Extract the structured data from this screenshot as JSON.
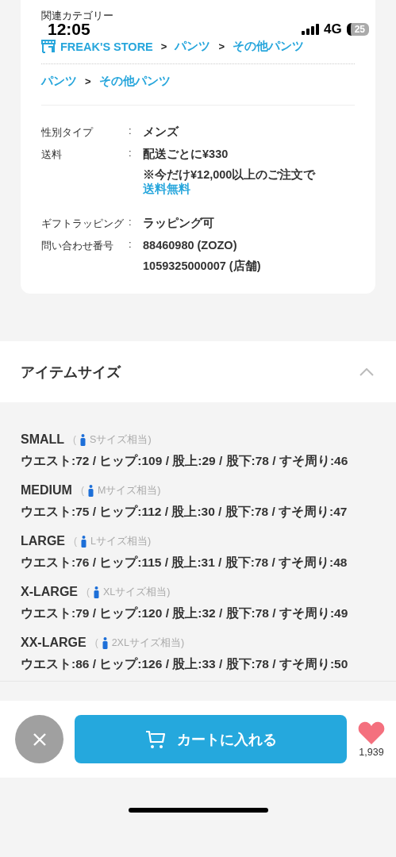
{
  "status_bar": {
    "time": "12:05",
    "network": "4G",
    "battery": "25"
  },
  "related_category": {
    "heading": "関連カテゴリー",
    "paths": [
      {
        "links": [
          {
            "text": "FREAK'S STORE",
            "kind": "shop"
          },
          {
            "separator": ">",
            "text": "パンツ"
          },
          {
            "separator": ">",
            "text": "その他パンツ"
          }
        ]
      },
      {
        "links": [
          {
            "text": "パンツ"
          },
          {
            "separator": ">",
            "text": "その他パンツ"
          }
        ]
      }
    ]
  },
  "details": [
    {
      "label": "性別タイプ",
      "colon": ":",
      "values": [
        {
          "text": "メンズ"
        }
      ]
    },
    {
      "label": "送料",
      "colon": ":",
      "values": [
        {
          "text": "配送ごとに¥330"
        },
        {
          "text": "※今だけ¥12,000以上のご注文で",
          "link": "送料無料"
        }
      ]
    },
    {
      "label": "ギフトラッピング",
      "colon": ":",
      "values": [
        {
          "text": "ラッピング可"
        }
      ]
    },
    {
      "label": "問い合わせ番号",
      "colon": ":",
      "values": [
        {
          "text": "88460980 (ZOZO)"
        },
        {
          "text": "1059325000007 (店舗)"
        }
      ]
    }
  ],
  "item_size": {
    "title": "アイテムサイズ",
    "expanded": true,
    "sizes": [
      {
        "name": "SMALL",
        "open": "(",
        "equivalent": "Sサイズ相当)",
        "measurements": "ウエスト:72 / ヒップ:109 / 股上:29 / 股下:78 / すそ周り:46"
      },
      {
        "name": "MEDIUM",
        "open": "(",
        "equivalent": "Mサイズ相当)",
        "measurements": "ウエスト:75 / ヒップ:112 / 股上:30 / 股下:78 / すそ周り:47"
      },
      {
        "name": "LARGE",
        "open": "(",
        "equivalent": "Lサイズ相当)",
        "measurements": "ウエスト:76 / ヒップ:115 / 股上:31 / 股下:78 / すそ周り:48"
      },
      {
        "name": "X-LARGE",
        "open": "(",
        "equivalent": "XLサイズ相当)",
        "measurements": "ウエスト:79 / ヒップ:120 / 股上:32 / 股下:78 / すそ周り:49"
      },
      {
        "name": "XX-LARGE",
        "open": "(",
        "equivalent": "2XLサイズ相当)",
        "measurements": "ウエスト:86 / ヒップ:126 / 股上:33 / 股下:78 / すそ周り:50"
      }
    ]
  },
  "bottom_bar": {
    "cart_button": "カートに入れる",
    "favorite_count": "1,939"
  }
}
